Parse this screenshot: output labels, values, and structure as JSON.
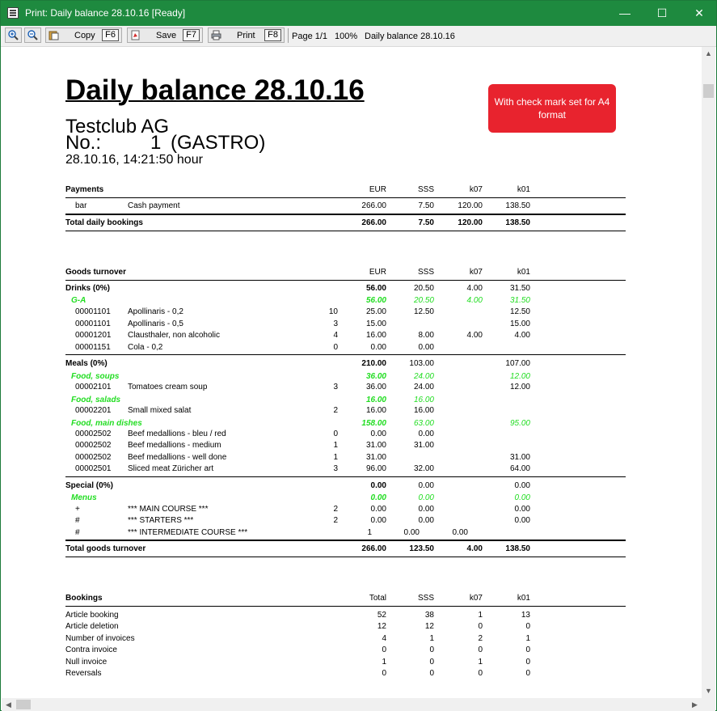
{
  "window": {
    "title": "Print: Daily balance 28.10.16 [Ready]",
    "minimize": "—",
    "maximize": "☐",
    "close": "✕"
  },
  "toolbar": {
    "copy_label": "Copy",
    "copy_key": "F6",
    "save_label": "Save",
    "save_key": "F7",
    "print_label": "Print",
    "print_key": "F8",
    "page_info": "Page 1/1",
    "zoom": "100%",
    "doc_name": "Daily balance 28.10.16"
  },
  "doc": {
    "title": "Daily balance 28.10.16",
    "company": "Testclub AG",
    "register_label": "No.:",
    "register_no": "1",
    "register_name": "(GASTRO)",
    "datetime": "28.10.16, 14:21:50 hour",
    "note": "With check mark set for A4 format"
  },
  "payments": {
    "header": [
      "Payments",
      "EUR",
      "SSS",
      "k07",
      "k01"
    ],
    "rows": [
      {
        "a": "bar",
        "b": "Cash payment",
        "v": [
          "266.00",
          "7.50",
          "120.00",
          "138.50"
        ]
      }
    ],
    "total": {
      "label": "Total daily bookings",
      "v": [
        "266.00",
        "7.50",
        "120.00",
        "138.50"
      ]
    }
  },
  "goods": {
    "header": [
      "Goods turnover",
      "EUR",
      "SSS",
      "k07",
      "k01"
    ],
    "rows": [
      {
        "kind": "cat",
        "label": "Drinks (0%)",
        "v": [
          "56.00",
          "20.50",
          "4.00",
          "31.50"
        ]
      },
      {
        "kind": "sub",
        "label": "G-A",
        "v": [
          "56.00",
          "20.50",
          "4.00",
          "31.50"
        ]
      },
      {
        "kind": "item",
        "code": "00001101",
        "name": "Apollinaris - 0,2",
        "qty": "10",
        "v": [
          "25.00",
          "12.50",
          "",
          "12.50"
        ]
      },
      {
        "kind": "item",
        "code": "00001101",
        "name": "Apollinaris - 0,5",
        "qty": "3",
        "v": [
          "15.00",
          "",
          "",
          "15.00"
        ]
      },
      {
        "kind": "item",
        "code": "00001201",
        "name": "Clausthaler, non alcoholic",
        "qty": "4",
        "v": [
          "16.00",
          "8.00",
          "4.00",
          "4.00"
        ]
      },
      {
        "kind": "item",
        "code": "00001151",
        "name": "Cola - 0,2",
        "qty": "0",
        "v": [
          "0.00",
          "0.00",
          "",
          ""
        ]
      },
      {
        "kind": "cat",
        "label": "Meals (0%)",
        "v": [
          "210.00",
          "103.00",
          "",
          "107.00"
        ]
      },
      {
        "kind": "sub",
        "label": "Food, soups",
        "v": [
          "36.00",
          "24.00",
          "",
          "12.00"
        ]
      },
      {
        "kind": "item",
        "code": "00002101",
        "name": "Tomatoes cream soup",
        "qty": "3",
        "v": [
          "36.00",
          "24.00",
          "",
          "12.00"
        ]
      },
      {
        "kind": "sub",
        "label": "Food, salads",
        "v": [
          "16.00",
          "16.00",
          "",
          ""
        ]
      },
      {
        "kind": "item",
        "code": "00002201",
        "name": "Small mixed salat",
        "qty": "2",
        "v": [
          "16.00",
          "16.00",
          "",
          ""
        ]
      },
      {
        "kind": "sub",
        "label": "Food, main dishes",
        "v": [
          "158.00",
          "63.00",
          "",
          "95.00"
        ]
      },
      {
        "kind": "item",
        "code": "00002502",
        "name": "Beef medallions - bleu / red",
        "qty": "0",
        "v": [
          "0.00",
          "0.00",
          "",
          ""
        ]
      },
      {
        "kind": "item",
        "code": "00002502",
        "name": "Beef medallions - medium",
        "qty": "1",
        "v": [
          "31.00",
          "31.00",
          "",
          ""
        ]
      },
      {
        "kind": "item",
        "code": "00002502",
        "name": "Beef medallions - well done",
        "qty": "1",
        "v": [
          "31.00",
          "",
          "",
          "31.00"
        ]
      },
      {
        "kind": "item",
        "code": "00002501",
        "name": "Sliced meat Züricher art",
        "qty": "3",
        "v": [
          "96.00",
          "32.00",
          "",
          "64.00"
        ]
      },
      {
        "kind": "cat",
        "label": "Special (0%)",
        "v": [
          "0.00",
          "0.00",
          "",
          "0.00"
        ]
      },
      {
        "kind": "sub",
        "label": "Menus",
        "v": [
          "0.00",
          "0.00",
          "",
          "0.00"
        ]
      },
      {
        "kind": "item",
        "code": "+",
        "name": "*** MAIN COURSE ***",
        "qty": "2",
        "v": [
          "0.00",
          "0.00",
          "",
          "0.00"
        ]
      },
      {
        "kind": "item",
        "code": "#",
        "name": "*** STARTERS  ***",
        "qty": "2",
        "v": [
          "0.00",
          "0.00",
          "",
          "0.00"
        ]
      },
      {
        "kind": "odd",
        "code": "#",
        "name": "*** INTERMEDIATE COURSE ***",
        "qty": "1",
        "v": [
          "0.00",
          "0.00"
        ]
      }
    ],
    "total": {
      "label": "Total goods turnover",
      "v": [
        "266.00",
        "123.50",
        "4.00",
        "138.50"
      ]
    }
  },
  "bookings": {
    "header": [
      "Bookings",
      "Total",
      "SSS",
      "k07",
      "k01"
    ],
    "rows": [
      {
        "label": "Article booking",
        "v": [
          "52",
          "38",
          "1",
          "13"
        ]
      },
      {
        "label": "Article deletion",
        "v": [
          "12",
          "12",
          "0",
          "0"
        ]
      },
      {
        "label": "Number of invoices",
        "v": [
          "4",
          "1",
          "2",
          "1"
        ]
      },
      {
        "label": "Contra invoice",
        "v": [
          "0",
          "0",
          "0",
          "0"
        ]
      },
      {
        "label": "Null invoice",
        "v": [
          "1",
          "0",
          "1",
          "0"
        ]
      },
      {
        "label": "Reversals",
        "v": [
          "0",
          "0",
          "0",
          "0"
        ]
      }
    ]
  }
}
